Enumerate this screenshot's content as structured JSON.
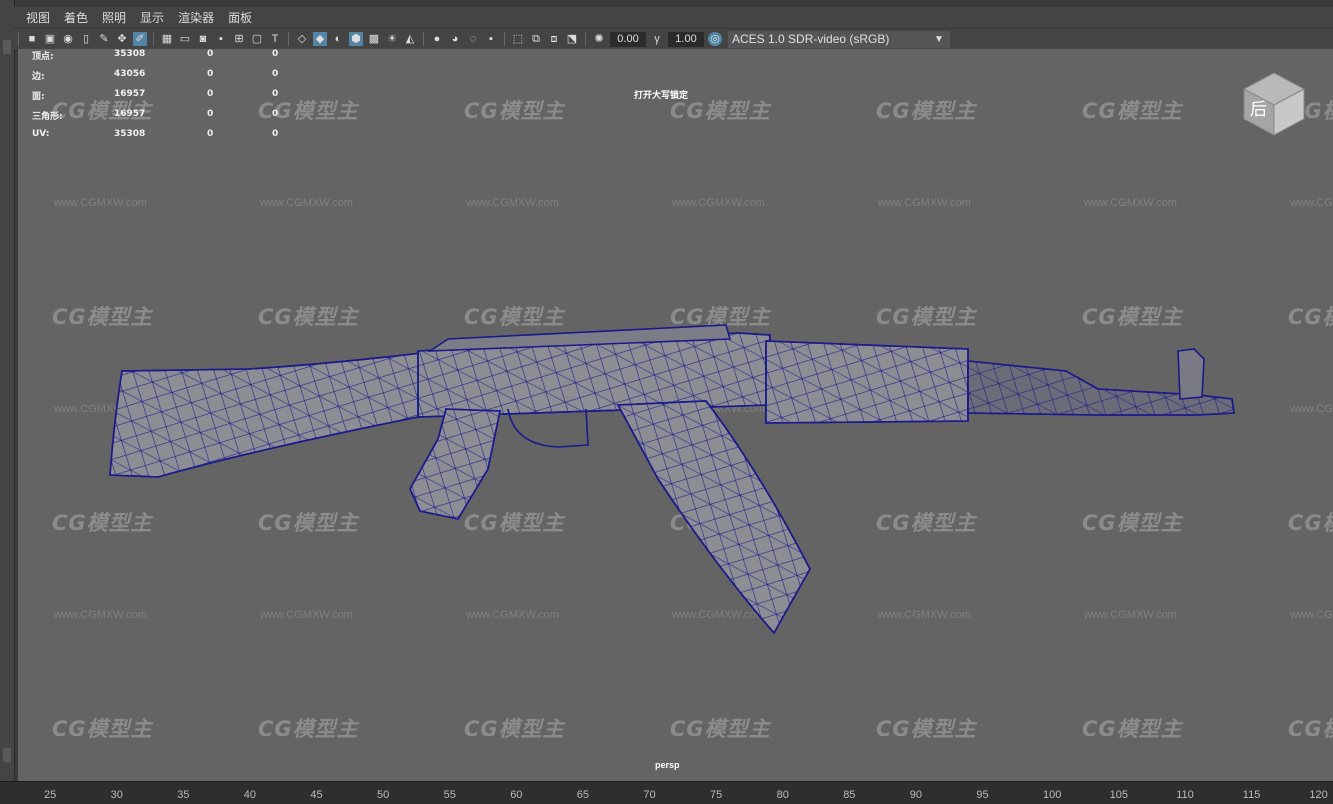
{
  "menu": [
    "视图",
    "着色",
    "照明",
    "显示",
    "渲染器",
    "面板"
  ],
  "toolbar": {
    "field_a": "0.00",
    "field_b": "1.00",
    "colorspace": "ACES 1.0 SDR-video (sRGB)"
  },
  "hud": {
    "rows": [
      {
        "label": "顶点:",
        "a": "35308",
        "b": "0",
        "c": "0"
      },
      {
        "label": "边:",
        "a": "43056",
        "b": "0",
        "c": "0"
      },
      {
        "label": "面:",
        "a": "16957",
        "b": "0",
        "c": "0"
      },
      {
        "label": "三角形:",
        "a": "16957",
        "b": "0",
        "c": "0"
      },
      {
        "label": "UV:",
        "a": "35308",
        "b": "0",
        "c": "0"
      }
    ]
  },
  "viewport": {
    "caps_lock": "打开大写锁定",
    "camera": "persp",
    "viewcube_face": "后"
  },
  "watermark": {
    "logo": "CG模型主",
    "url": "www.CGMXW.com"
  },
  "ruler": [
    "25",
    "30",
    "35",
    "40",
    "45",
    "50",
    "55",
    "60",
    "65",
    "70",
    "75",
    "80",
    "85",
    "90",
    "95",
    "100",
    "105",
    "110",
    "115",
    "120"
  ],
  "colors": {
    "background": "#646464",
    "wireframe": "#1a1a8c",
    "active_icon": "#5285a6"
  }
}
